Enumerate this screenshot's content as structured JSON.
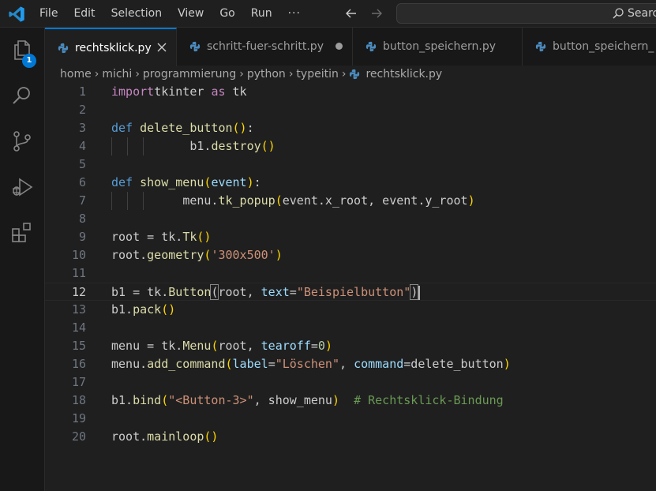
{
  "menu": [
    "File",
    "Edit",
    "Selection",
    "View",
    "Go",
    "Run"
  ],
  "menu_more": "···",
  "command_center": {
    "text": "Search"
  },
  "activity": {
    "explorer_badge": "1"
  },
  "tabs": [
    {
      "label": "rechtsklick.py",
      "active": true
    },
    {
      "label": "schritt-fuer-schritt.py",
      "modified": true
    },
    {
      "label": "button_speichern.py"
    },
    {
      "label": "button_speichern_"
    }
  ],
  "breadcrumb": [
    "home",
    "michi",
    "programmierung",
    "python",
    "typeitin",
    "rechtsklick.py"
  ],
  "editor": {
    "current_line": 12,
    "lines": [
      {
        "n": "1",
        "tokens": [
          [
            "kw",
            "import"
          ],
          [
            "",
            "tkinter "
          ],
          [
            "kw",
            "as"
          ],
          [
            "",
            " tk"
          ]
        ]
      },
      {
        "n": "2",
        "tokens": []
      },
      {
        "n": "3",
        "tokens": [
          [
            "def",
            "def"
          ],
          [
            "",
            ""
          ],
          [
            "fn",
            " delete_button"
          ],
          [
            "br",
            "()"
          ],
          [
            "",
            ":"
          ]
        ]
      },
      {
        "n": "4",
        "indent": 2,
        "tokens": [
          [
            "",
            "b1."
          ],
          [
            "fn",
            "destroy"
          ],
          [
            "br",
            "()"
          ]
        ]
      },
      {
        "n": "5",
        "tokens": []
      },
      {
        "n": "6",
        "tokens": [
          [
            "def",
            "def"
          ],
          [
            "fn",
            " show_menu"
          ],
          [
            "br",
            "("
          ],
          [
            "param",
            "event"
          ],
          [
            "br",
            ")"
          ],
          [
            "",
            ":"
          ]
        ]
      },
      {
        "n": "7",
        "indent": 2,
        "tokens": [
          [
            "",
            "menu."
          ],
          [
            "fn",
            "tk_popup"
          ],
          [
            "br",
            "("
          ],
          [
            "",
            "event.x_root, event.y_root"
          ],
          [
            "br",
            ")"
          ]
        ]
      },
      {
        "n": "8",
        "tokens": []
      },
      {
        "n": "9",
        "tokens": [
          [
            "",
            "root = tk."
          ],
          [
            "fn",
            "Tk"
          ],
          [
            "br",
            "()"
          ]
        ]
      },
      {
        "n": "10",
        "tokens": [
          [
            "",
            "root."
          ],
          [
            "fn",
            "geometry"
          ],
          [
            "br",
            "("
          ],
          [
            "str",
            "'300x500'"
          ],
          [
            "br",
            ")"
          ]
        ]
      },
      {
        "n": "11",
        "tokens": []
      },
      {
        "n": "12",
        "tokens": [
          [
            "",
            "b1 = tk."
          ],
          [
            "fn",
            "Button"
          ],
          [
            "bm",
            "("
          ],
          [
            "",
            "root, "
          ],
          [
            "param",
            "text"
          ],
          [
            "",
            "="
          ],
          [
            "str",
            "\"Beispielbutton\""
          ],
          [
            "bm",
            ")"
          ]
        ]
      },
      {
        "n": "13",
        "tokens": [
          [
            "",
            "b1."
          ],
          [
            "fn",
            "pack"
          ],
          [
            "br",
            "()"
          ]
        ]
      },
      {
        "n": "14",
        "tokens": []
      },
      {
        "n": "15",
        "tokens": [
          [
            "",
            "menu = tk."
          ],
          [
            "fn",
            "Menu"
          ],
          [
            "br",
            "("
          ],
          [
            "",
            "root, "
          ],
          [
            "param",
            "tearoff"
          ],
          [
            "",
            "="
          ],
          [
            "num",
            "0"
          ],
          [
            "br",
            ")"
          ]
        ]
      },
      {
        "n": "16",
        "tokens": [
          [
            "",
            "menu."
          ],
          [
            "fn",
            "add_command"
          ],
          [
            "br",
            "("
          ],
          [
            "param",
            "label"
          ],
          [
            "",
            "="
          ],
          [
            "str",
            "\"Löschen\""
          ],
          [
            "",
            ", "
          ],
          [
            "param",
            "command"
          ],
          [
            "",
            "=delete_button"
          ],
          [
            "br",
            ")"
          ]
        ]
      },
      {
        "n": "17",
        "tokens": []
      },
      {
        "n": "18",
        "tokens": [
          [
            "",
            "b1."
          ],
          [
            "fn",
            "bind"
          ],
          [
            "br",
            "("
          ],
          [
            "str",
            "\"<Button-3>\""
          ],
          [
            "",
            ", show_menu"
          ],
          [
            "br",
            ")"
          ],
          [
            "",
            "  "
          ],
          [
            "cmt",
            "# Rechtsklick-Bindung"
          ]
        ]
      },
      {
        "n": "19",
        "tokens": []
      },
      {
        "n": "20",
        "tokens": [
          [
            "",
            "root."
          ],
          [
            "fn",
            "mainloop"
          ],
          [
            "br",
            "()"
          ]
        ]
      }
    ]
  }
}
